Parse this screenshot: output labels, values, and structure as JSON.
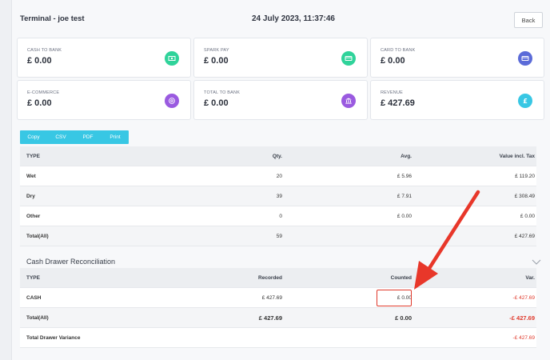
{
  "header": {
    "title": "Terminal - joe test",
    "datetime": "24 July 2023, 11:37:46",
    "back_label": "Back"
  },
  "cards": [
    {
      "label": "CASH TO BANK",
      "value": "£ 0.00",
      "icon": "cash-icon",
      "color": "#2fd39a"
    },
    {
      "label": "SPARK PAY",
      "value": "£ 0.00",
      "icon": "card-icon",
      "color": "#2fd39a"
    },
    {
      "label": "CARD TO BANK",
      "value": "£ 0.00",
      "icon": "card-icon",
      "color": "#5b6bd8"
    },
    {
      "label": "E-COMMERCE",
      "value": "£ 0.00",
      "icon": "at-icon",
      "color": "#9a5ae0"
    },
    {
      "label": "TOTAL TO BANK",
      "value": "£ 0.00",
      "icon": "bank-icon",
      "color": "#9a5ae0"
    },
    {
      "label": "REVENUE",
      "value": "£ 427.69",
      "icon": "pound-icon",
      "color": "#38c7e4"
    }
  ],
  "export_buttons": [
    "Copy",
    "CSV",
    "PDF",
    "Print"
  ],
  "sales_table": {
    "columns": [
      "TYPE",
      "Qty.",
      "Avg.",
      "Value incl. Tax"
    ],
    "rows": [
      [
        "Wet",
        "20",
        "£ 5.96",
        "£ 119.20"
      ],
      [
        "Dry",
        "39",
        "£ 7.91",
        "£ 308.49"
      ],
      [
        "Other",
        "0",
        "£ 0.00",
        "£ 0.00"
      ],
      [
        "Total(All)",
        "59",
        "",
        "£ 427.69"
      ]
    ]
  },
  "reconciliation": {
    "title": "Cash Drawer Reconciliation",
    "columns": [
      "TYPE",
      "Recorded",
      "Counted",
      "Var."
    ],
    "cash_row": [
      "CASH",
      "£ 427.69",
      "£ 0.00",
      "-£ 427.69"
    ],
    "total_row": [
      "Total(All)",
      "£ 427.69",
      "£ 0.00",
      "-£ 427.69"
    ],
    "variance_row": [
      "Total Drawer Variance",
      "-£ 427.69"
    ]
  },
  "colors": {
    "accent": "#38c7e4",
    "negative": "#e0392b",
    "annotation": "#e0392b"
  }
}
